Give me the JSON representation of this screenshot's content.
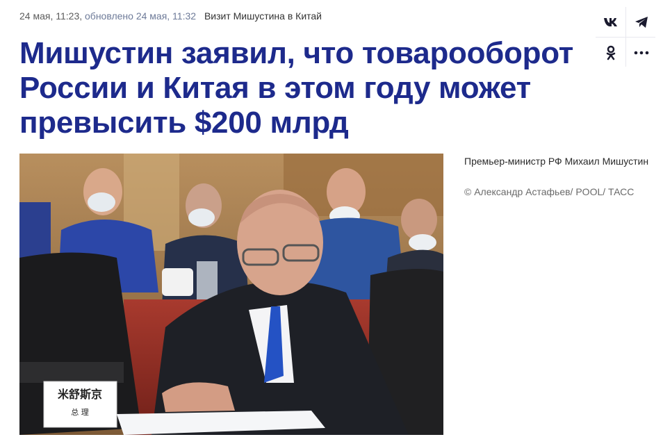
{
  "meta": {
    "date": "24 мая, 11:23,",
    "updated": "обновлено 24 мая, 11:32",
    "tag": "Визит Мишустина в Китай"
  },
  "share": [
    {
      "name": "vk",
      "glyph": "vk"
    },
    {
      "name": "telegram",
      "glyph": ""
    },
    {
      "name": "odnoklassniki",
      "glyph": ""
    },
    {
      "name": "more",
      "glyph": "•••"
    }
  ],
  "article": {
    "title": "Мишустин заявил, что товарооборот России и Китая в этом году может превысить $200 млрд"
  },
  "photo": {
    "caption": "Премьер-министр РФ Михаил Мишустин",
    "credit": "© Александр Астафьев/ POOL/ ТАСС",
    "nameplate_line1": "米舒斯京",
    "nameplate_line2": "总 理"
  },
  "colors": {
    "title": "#1d2a8c",
    "meta_updated": "#6d7a98"
  }
}
